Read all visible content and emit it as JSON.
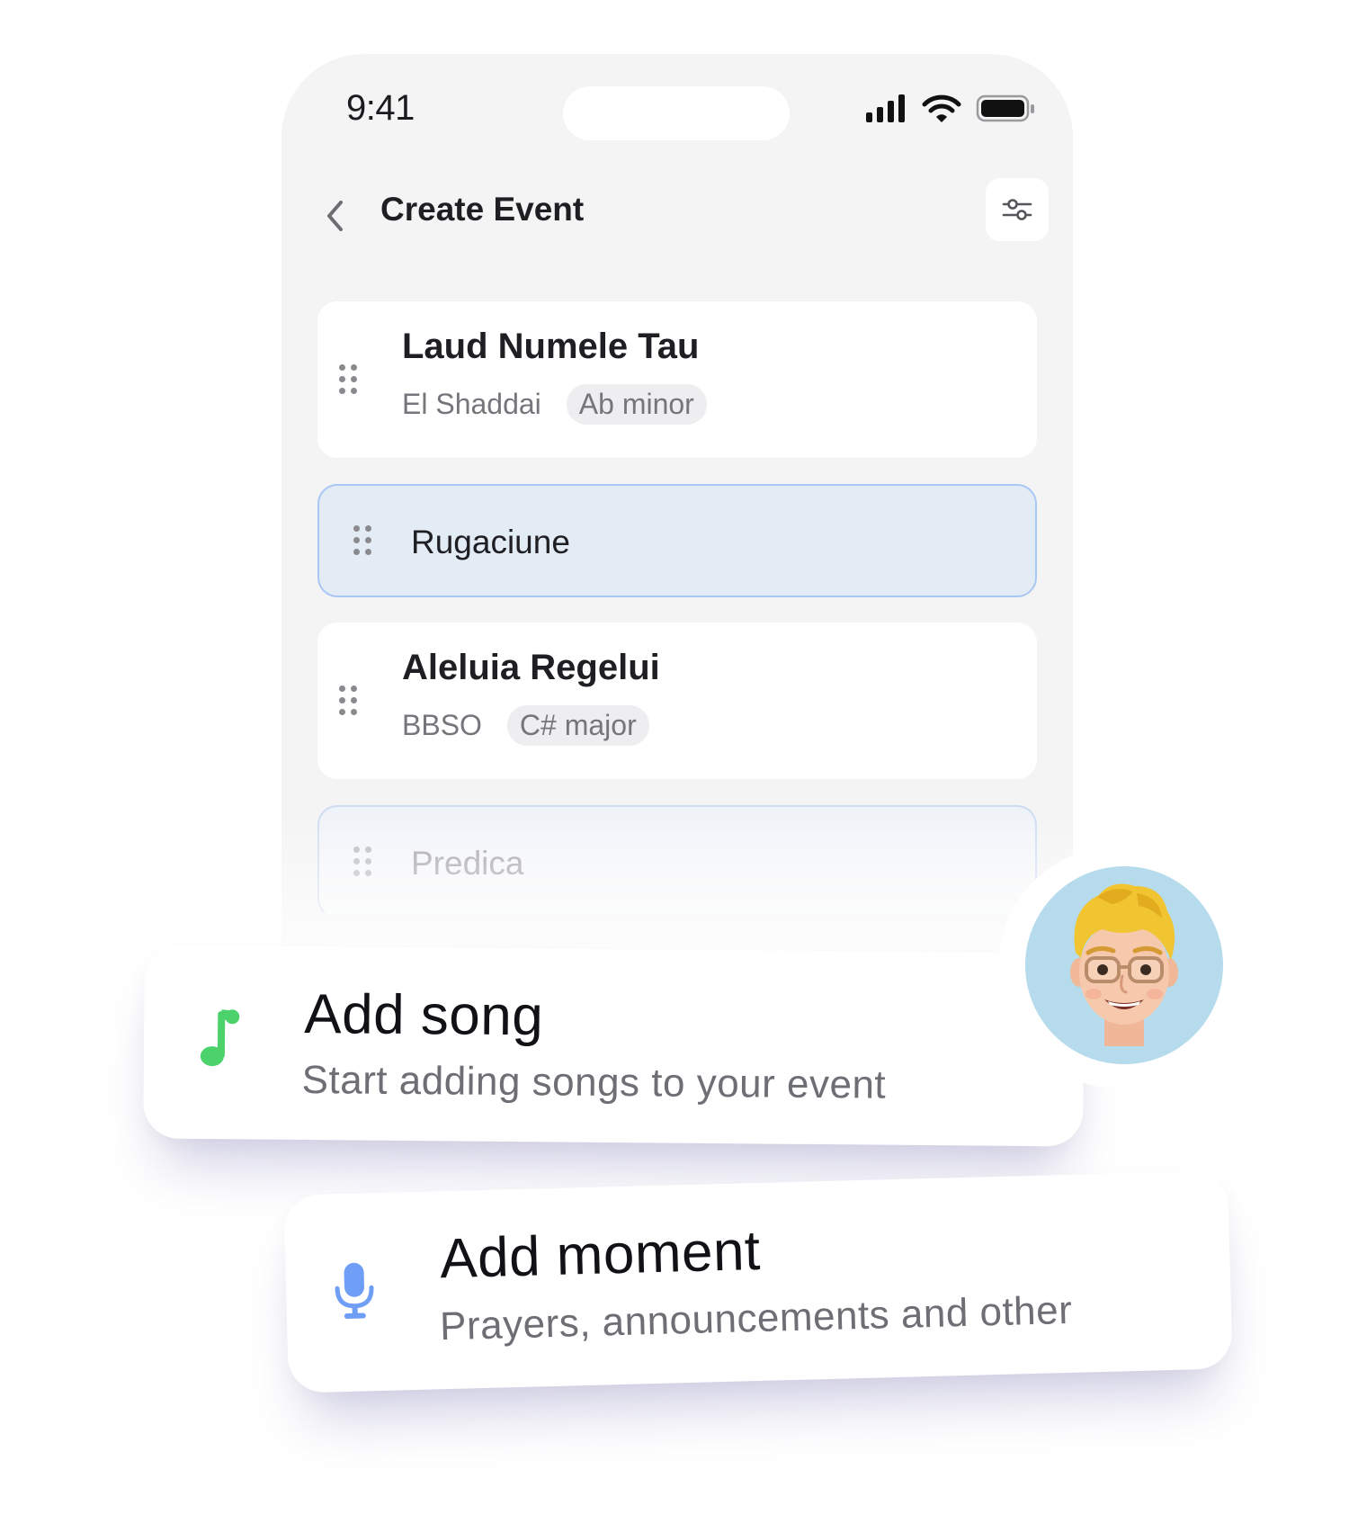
{
  "status_bar": {
    "time": "9:41"
  },
  "header": {
    "title": "Create Event",
    "back_icon": "chevron-left-icon",
    "filter_icon": "sliders-icon"
  },
  "items": [
    {
      "type": "song",
      "title": "Laud Numele Tau",
      "artist": "El Shaddai",
      "key": "Ab minor"
    },
    {
      "type": "moment",
      "label": "Rugaciune"
    },
    {
      "type": "song",
      "title": "Aleluia Regelui",
      "artist": "BBSO",
      "key": "C# major"
    },
    {
      "type": "moment",
      "label": "Predica"
    }
  ],
  "popups": {
    "add_song": {
      "title": "Add song",
      "subtitle": "Start adding songs to your event",
      "icon": "music-note-icon",
      "icon_color": "#4cd26b"
    },
    "add_moment": {
      "title": "Add moment",
      "subtitle": "Prayers, announcements and other",
      "icon": "microphone-icon",
      "icon_color": "#6e9ef5"
    }
  },
  "avatar": {
    "icon": "memoji-avatar-icon",
    "background": "#b6dbec"
  },
  "colors": {
    "phone_bg": "#f4f4f5",
    "moment_card_bg": "#e3ebf5",
    "moment_card_border": "#a9c7f4",
    "text_primary": "#1f1f23",
    "text_secondary": "#75757b"
  }
}
